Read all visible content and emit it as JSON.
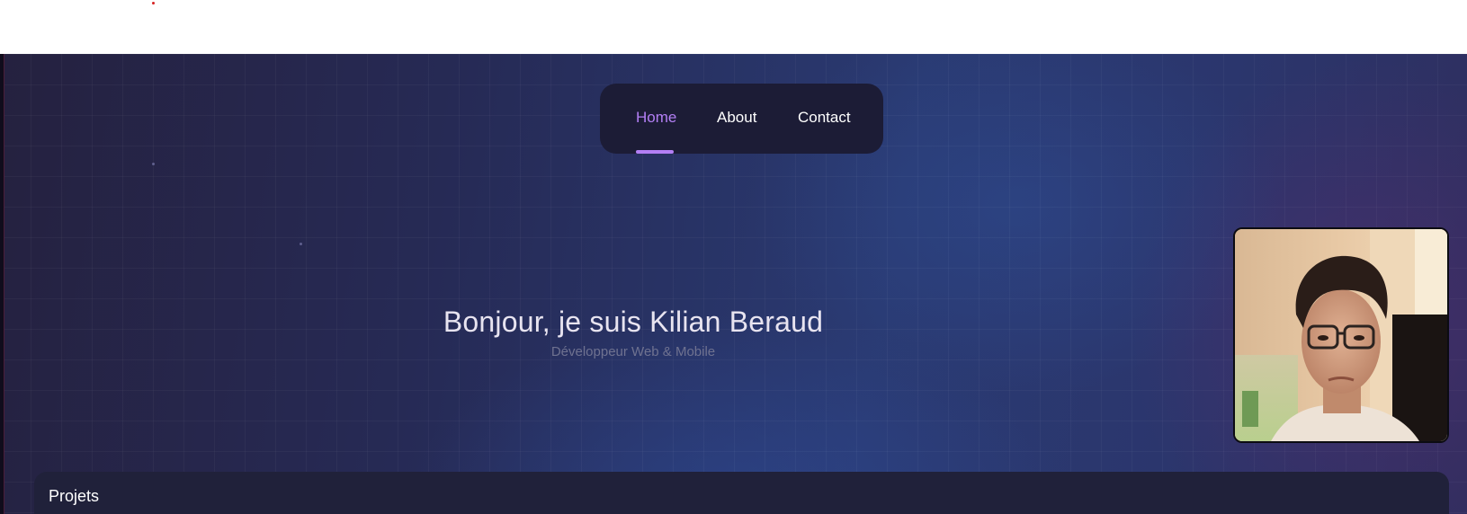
{
  "nav": {
    "items": [
      {
        "label": "Home",
        "active": true
      },
      {
        "label": "About",
        "active": false
      },
      {
        "label": "Contact",
        "active": false
      }
    ],
    "active_color": "#b37ff5"
  },
  "hero": {
    "title": "Bonjour, je suis Kilian Beraud",
    "subtitle": "Développeur Web & Mobile"
  },
  "projects": {
    "title": "Projets"
  },
  "colors": {
    "accent": "#b37ff5",
    "nav_bg": "#1c1c36",
    "panel_bg": "#20213a"
  },
  "icons": [
    "profile-photo"
  ]
}
